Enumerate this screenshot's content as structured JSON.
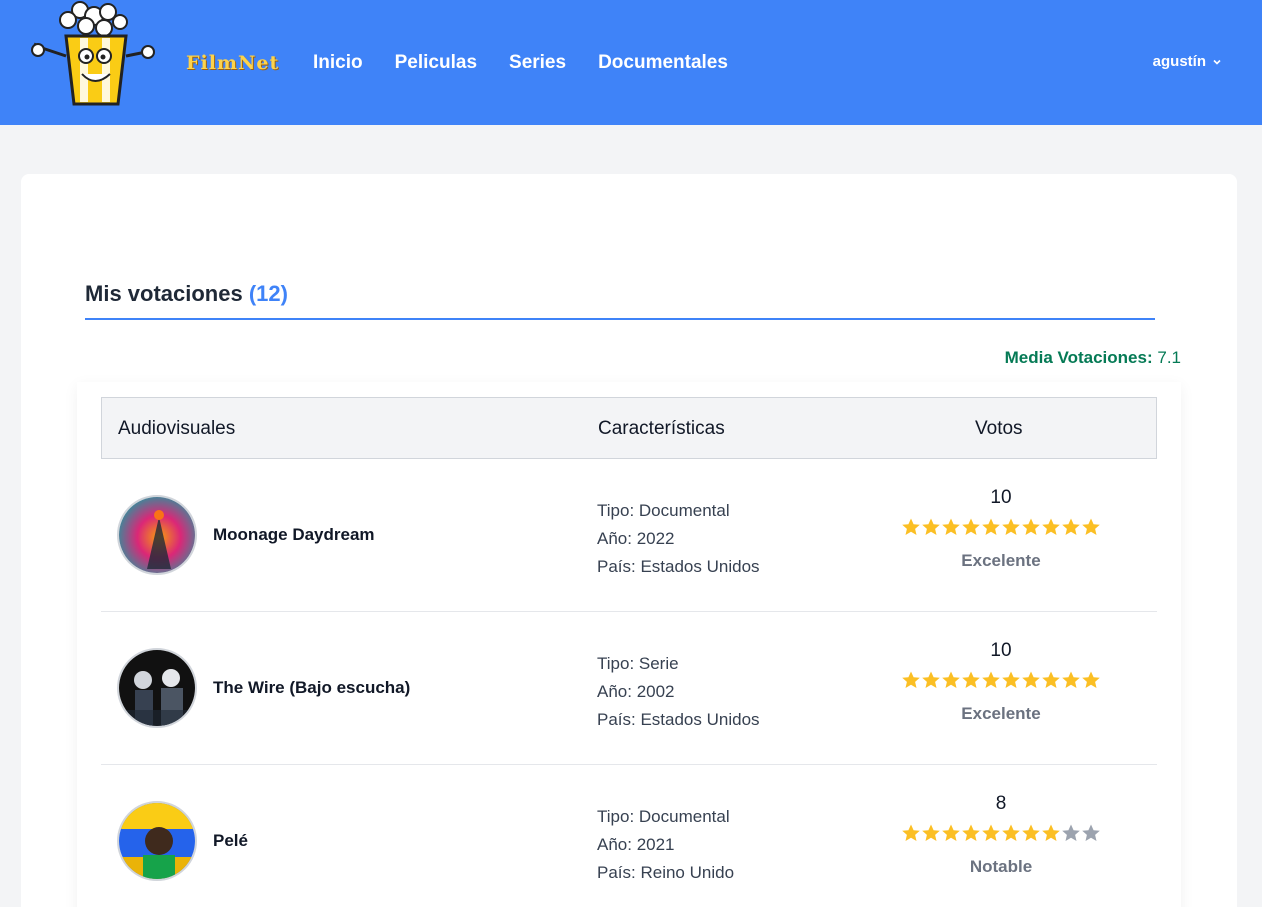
{
  "brand": {
    "name": "FilmNet"
  },
  "nav": {
    "items": [
      "Inicio",
      "Peliculas",
      "Series",
      "Documentales"
    ]
  },
  "user": {
    "name": "agustín"
  },
  "section": {
    "title": "Mis votaciones",
    "count": "(12)"
  },
  "average": {
    "label": "Media Votaciones:",
    "value": "7.1"
  },
  "table": {
    "headers": {
      "audiovisuales": "Audiovisuales",
      "caracteristicas": "Características",
      "votos": "Votos"
    },
    "rows": [
      {
        "title": "Moonage Daydream",
        "tipo": "Tipo: Documental",
        "anio": "Año: 2022",
        "pais": "País: Estados Unidos",
        "vote": "10",
        "stars_filled": 10,
        "stars_total": 10,
        "label": "Excelente"
      },
      {
        "title": "The Wire (Bajo escucha)",
        "tipo": "Tipo: Serie",
        "anio": "Año: 2002",
        "pais": "País: Estados Unidos",
        "vote": "10",
        "stars_filled": 10,
        "stars_total": 10,
        "label": "Excelente"
      },
      {
        "title": "Pelé",
        "tipo": "Tipo: Documental",
        "anio": "Año: 2021",
        "pais": "País: Reino Unido",
        "vote": "8",
        "stars_filled": 8,
        "stars_total": 10,
        "label": "Notable"
      }
    ]
  },
  "colors": {
    "navbar": "#3f83f8",
    "accent": "#3f83f8",
    "star_on": "#fbbf24",
    "star_off": "#9ca3af",
    "average": "#057a55"
  },
  "icons": {
    "user_menu": "chevron-down-icon",
    "star": "star-icon",
    "logo": "popcorn-logo"
  }
}
